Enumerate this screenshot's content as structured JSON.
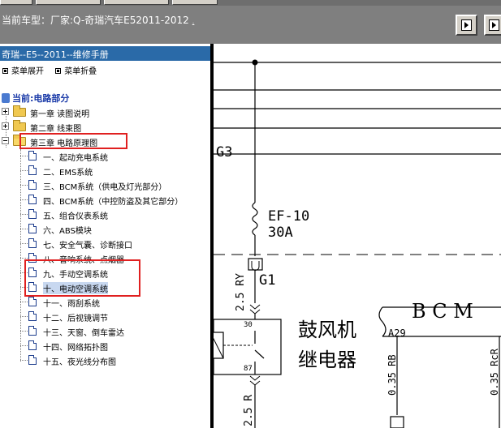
{
  "header": {
    "vehicle_label": "当前车型：",
    "vehicle_value": "厂家:Q-奇瑞汽车E52011-2012",
    "vehicle_link": "."
  },
  "sidebar": {
    "title": "奇瑞--E5--2011--维修手册",
    "expand_menu": "菜单展开",
    "collapse_menu": "菜单折叠",
    "current_label": "当前:电路部分",
    "chapters": [
      {
        "label": "第一章 读图说明",
        "state": "collapsed"
      },
      {
        "label": "第二章 线束图",
        "state": "collapsed"
      },
      {
        "label": "第三章 电路原理图",
        "state": "expanded"
      }
    ],
    "items": [
      "一、起动充电系统",
      "二、EMS系统",
      "三、BCM系统（供电及灯光部分）",
      "四、BCM系统（中控防盗及其它部分）",
      "五、组合仪表系统",
      "六、ABS模块",
      "七、安全气囊、诊断接口",
      "八、音响系统、点烟器",
      "九、手动空调系统",
      "十、电动空调系统",
      "十一、雨刮系统",
      "十二、后视镜调节",
      "十三、天窗、倒车雷达",
      "十四、网络拓扑图",
      "十五、夜光线分布图"
    ],
    "selected_index": 9
  },
  "diagram": {
    "connector_g3": "G3",
    "fuse_name": "EF-10",
    "fuse_rating": "30A",
    "wire_top": "2.5 RY",
    "connector_g1": "G1",
    "relay_name_line1": "鼓风机",
    "relay_name_line2": "继电器",
    "pin_30": "30",
    "pin_87": "87",
    "wire_bottom": "2.5 R",
    "bcm_label": "B C M",
    "bcm_pin": "A29",
    "bcm_wire": "0.35 RB",
    "bcm_wire2": "0.35 RcR"
  },
  "colors": {
    "header_bg": "#7f7f7f",
    "title_bg": "#2a6aa8",
    "highlight_box": "#e02020",
    "current_text": "#1a3aa8"
  }
}
